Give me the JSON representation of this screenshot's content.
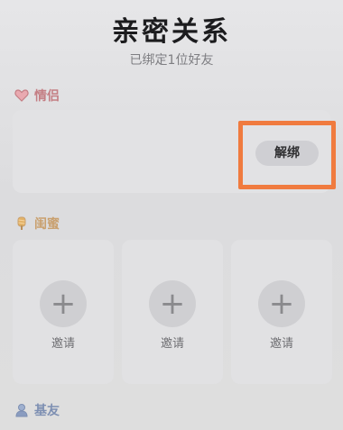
{
  "header": {
    "title": "亲密关系",
    "subtitle": "已绑定1位好友"
  },
  "sections": {
    "couple": {
      "label": "情侣",
      "icon": "heart-icon",
      "color": "#c47e84",
      "unbind_label": "解绑"
    },
    "bestie": {
      "label": "闺蜜",
      "icon": "popsicle-icon",
      "color": "#c9a06e",
      "slots": [
        {
          "label": "邀请"
        },
        {
          "label": "邀请"
        },
        {
          "label": "邀请"
        }
      ]
    },
    "friend": {
      "label": "基友",
      "icon": "friend-icon",
      "color": "#7d8fb2"
    }
  },
  "highlight_color": "#f07b3f"
}
